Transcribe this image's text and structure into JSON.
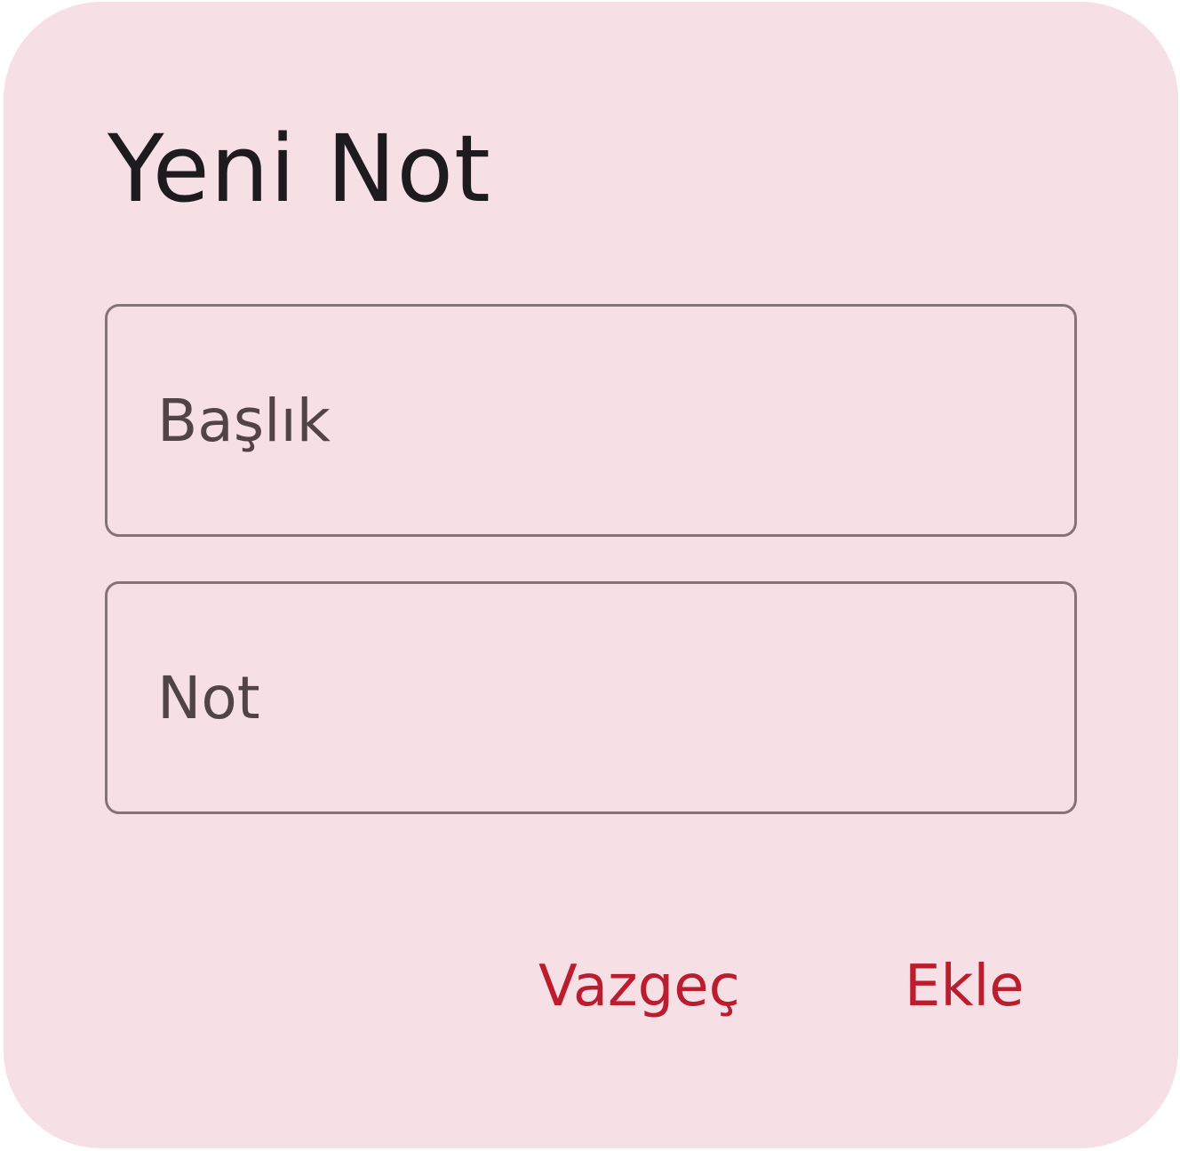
{
  "dialog": {
    "title": "Yeni Not",
    "fields": {
      "title_field": {
        "value": "",
        "placeholder": "Başlık"
      },
      "note_field": {
        "value": "",
        "placeholder": "Not"
      }
    },
    "actions": {
      "cancel_label": "Vazgeç",
      "add_label": "Ekle"
    }
  },
  "colors": {
    "dialog_background": "#f6e0e6",
    "title_text": "#1d1b1e",
    "field_border": "#857375",
    "field_text": "#524346",
    "action_text": "#bb1d2e"
  }
}
